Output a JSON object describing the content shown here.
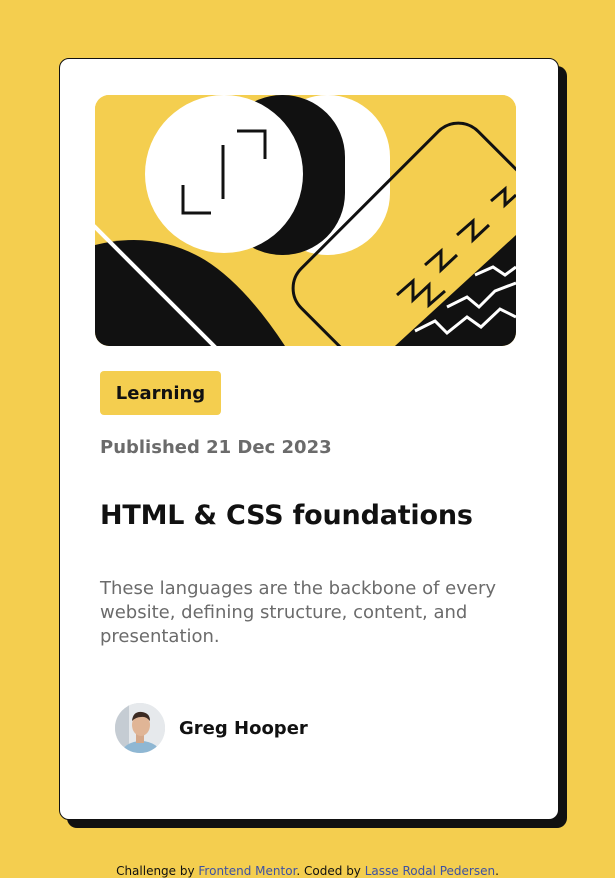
{
  "card": {
    "tag": "Learning",
    "published": "Published 21 Dec 2023",
    "title": "HTML & CSS foundations",
    "description": "These languages are the backbone of every website, defining structure, content, and presentation.",
    "author": {
      "name": "Greg Hooper"
    }
  },
  "footer": {
    "prefix": "Challenge by ",
    "fm_link": "Frontend Mentor",
    "middle": ". Coded by ",
    "author_link": "Lasse Rodal Pedersen",
    "suffix": "."
  },
  "colors": {
    "background": "#F4CE4F",
    "tag": "#F4CE4F",
    "text": "#111111",
    "muted": "#6b6b6b",
    "link": "#3e52a3"
  },
  "icons": {
    "hero": "abstract-illustration",
    "avatar": "author-photo"
  }
}
